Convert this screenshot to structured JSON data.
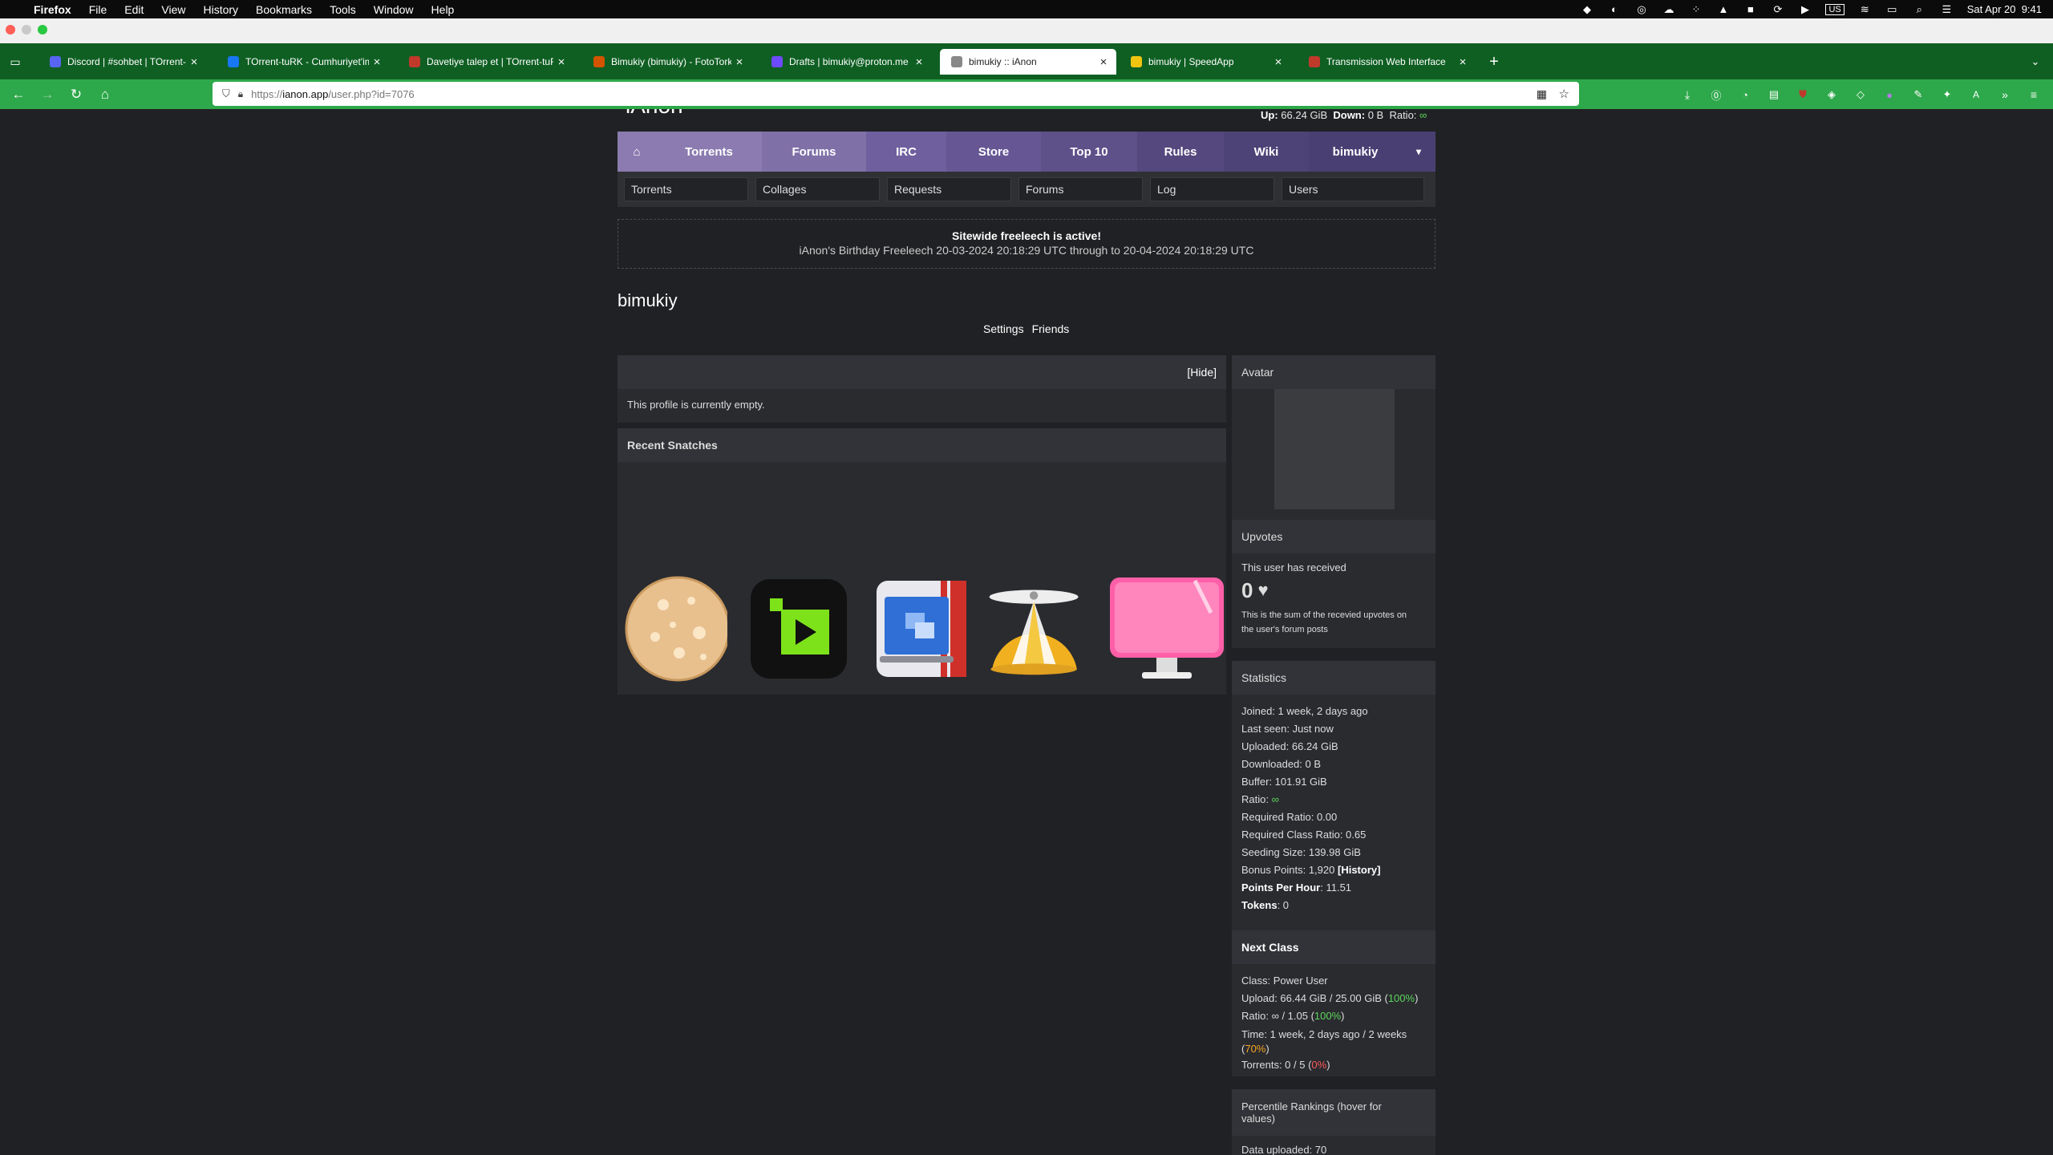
{
  "menubar": {
    "app": "Firefox",
    "items": [
      "File",
      "Edit",
      "View",
      "History",
      "Bookmarks",
      "Tools",
      "Window",
      "Help"
    ],
    "clock": "Sat Apr 20  9:41",
    "input": "US"
  },
  "tabs": [
    {
      "title": "Discord | #sohbet | TOrrent-tuRK",
      "icon": "discord-icon",
      "color": "#5865f2",
      "active": false
    },
    {
      "title": "TOrrent-tuRK - Cumhuriyet'imiz",
      "icon": "facebook-icon",
      "color": "#1877f2",
      "active": false
    },
    {
      "title": "Davetiye talep et | TOrrent-tuRK",
      "icon": "pokeball-icon",
      "color": "#c0392b",
      "active": false
    },
    {
      "title": "Bimukiy (bimukiy) - FotoTork",
      "icon": "fototork-icon",
      "color": "#d35400",
      "active": false
    },
    {
      "title": "Drafts | bimukiy@proton.me | Pr",
      "icon": "proton-icon",
      "color": "#6d4aff",
      "active": false
    },
    {
      "title": "bimukiy :: iAnon",
      "icon": "apple-icon",
      "color": "#888888",
      "active": true
    },
    {
      "title": "bimukiy | SpeedApp",
      "icon": "speedapp-icon",
      "color": "#f1c40f",
      "active": false
    },
    {
      "title": "Transmission Web Interface",
      "icon": "transmission-icon",
      "color": "#c0392b",
      "active": false
    }
  ],
  "url": {
    "prefix": "https://",
    "host": "ianon.app",
    "path": "/user.php?id=7076"
  },
  "site": {
    "logo": "iAnon",
    "stats_top": {
      "up_label": "Up:",
      "up": "66.24 GiB",
      "down_label": "Down:",
      "down": "0 B",
      "ratio_label": "Ratio:",
      "ratio": "∞"
    },
    "nav": [
      {
        "label": "⌂",
        "name": "nav-home"
      },
      {
        "label": "Torrents",
        "name": "nav-torrents"
      },
      {
        "label": "Forums",
        "name": "nav-forums"
      },
      {
        "label": "IRC",
        "name": "nav-irc"
      },
      {
        "label": "Store",
        "name": "nav-store"
      },
      {
        "label": "Top 10",
        "name": "nav-top10"
      },
      {
        "label": "Rules",
        "name": "nav-rules"
      },
      {
        "label": "Wiki",
        "name": "nav-wiki"
      },
      {
        "label": "bimukiy",
        "name": "nav-user"
      },
      {
        "label": "▾",
        "name": "nav-dropdown"
      }
    ],
    "subnav": [
      "Torrents",
      "Collages",
      "Requests",
      "Forums",
      "Log",
      "Users"
    ],
    "notice": {
      "title": "Sitewide freeleech is active!",
      "text": "iAnon's Birthday Freeleech 20-03-2024 20:18:29 UTC through to 20-04-2024 20:18:29 UTC"
    },
    "username": "bimukiy",
    "links": [
      "Settings",
      "Friends"
    ],
    "profile": {
      "hide": "[Hide]",
      "empty": "This profile is currently empty."
    },
    "recent": {
      "title": "Recent Snatches",
      "apps": [
        "cookie-app-icon",
        "camo-app-icon",
        "parallels-app-icon",
        "little-snitch-app-icon",
        "cleanmymac-app-icon"
      ]
    },
    "avatar": {
      "title": "Avatar"
    },
    "upvotes": {
      "title": "Upvotes",
      "received": "This user has received",
      "count": "0",
      "note1": "This is the sum of the recevied upvotes on",
      "note2": "the user's forum posts"
    },
    "statistics": {
      "title": "Statistics",
      "joined": "Joined: 1 week, 2 days ago",
      "last_seen": "Last seen: Just now",
      "uploaded": "Uploaded: 66.24 GiB",
      "downloaded": "Downloaded: 0 B",
      "buffer": "Buffer: 101.91 GiB",
      "ratio_label": "Ratio: ",
      "ratio": "∞",
      "required_ratio": "Required Ratio: 0.00",
      "required_class_ratio": "Required Class Ratio: 0.65",
      "seeding_size": "Seeding Size: 139.98 GiB",
      "bonus_points": "Bonus Points: 1,920 ",
      "history": "[History]",
      "pph_label": "Points Per Hour",
      "pph": ": 11.51",
      "tokens_label": "Tokens",
      "tokens": ": 0"
    },
    "next_class": {
      "title": "Next Class",
      "class": "Class: Power User",
      "upload": "Upload: 66.44 GiB / 25.00 GiB (",
      "upload_pct": "100%",
      "ratio": "Ratio: ∞ / 1.05 (",
      "ratio_pct": "100%",
      "time": "Time: 1 week, 2 days ago / 2 weeks",
      "time_pct": "70%",
      "torrents": "Torrents: 0 / 5 (",
      "torrents_pct": "0%",
      "close": ")"
    },
    "percentile": {
      "title1": "Percentile Rankings (hover for",
      "title2": "values)",
      "first": "Data uploaded: 70"
    }
  },
  "colors": {
    "nav_light": "#8b7bb0",
    "nav_mid": "#6f5f9e",
    "nav_dark": "#4a3f73",
    "tab_bar": "#0f5f23",
    "nav_bar": "#2da84a"
  }
}
